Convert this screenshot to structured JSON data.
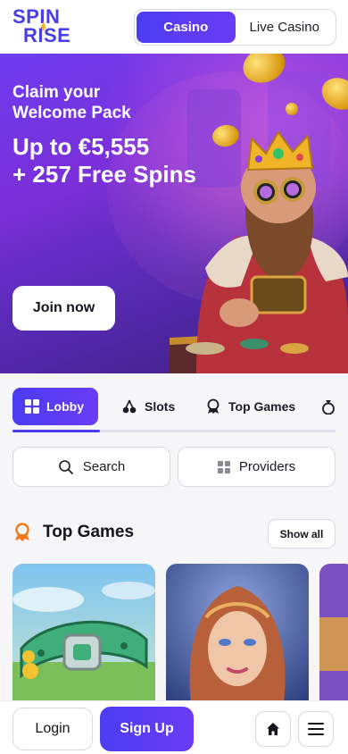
{
  "brand": {
    "logo_line1": "SPIN",
    "logo_line2": "RISE",
    "accent": "#4b3cf2"
  },
  "header": {
    "tabs": [
      {
        "label": "Casino",
        "active": true
      },
      {
        "label": "Live Casino",
        "active": false
      }
    ]
  },
  "banner": {
    "headline": "Claim your Welcome Pack",
    "bonus_line1": "Up to €5,555",
    "bonus_line2": "+ 257 Free Spins",
    "cta": "Join now"
  },
  "categories": {
    "tabs": [
      {
        "label": "Lobby",
        "icon": "grid-icon",
        "active": true
      },
      {
        "label": "Slots",
        "icon": "cherries-icon",
        "active": false
      },
      {
        "label": "Top Games",
        "icon": "medal-icon",
        "active": false
      }
    ],
    "scroll_progress": 0.27
  },
  "actions": {
    "search_label": "Search",
    "providers_label": "Providers"
  },
  "top_games": {
    "title": "Top Games",
    "show_all": "Show all"
  },
  "bottom_nav": {
    "login": "Login",
    "signup": "Sign Up",
    "home_icon": "home-icon",
    "menu_icon": "hamburger-menu-icon"
  }
}
